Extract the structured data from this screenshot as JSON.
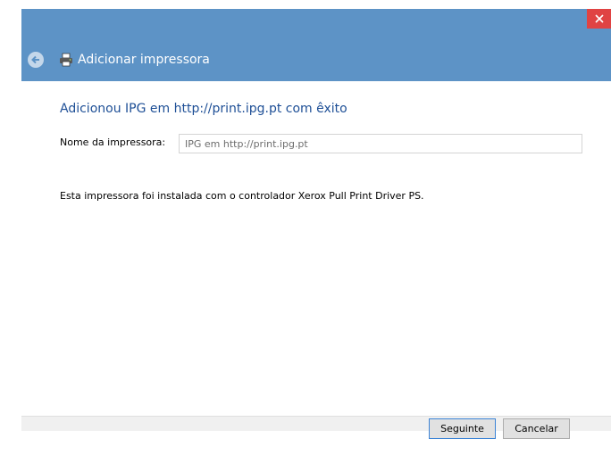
{
  "window": {
    "title": "Adicionar impressora"
  },
  "content": {
    "heading": "Adicionou IPG em http://print.ipg.pt com êxito",
    "printer_name_label": "Nome da impressora:",
    "printer_name_value": "IPG em http://print.ipg.pt",
    "info": "Esta impressora foi instalada com o controlador Xerox Pull Print Driver PS."
  },
  "footer": {
    "next_label": "Seguinte",
    "cancel_label": "Cancelar"
  },
  "colors": {
    "header_bg": "#5d93c6",
    "close_bg": "#e04343",
    "heading_text": "#1e4f96"
  },
  "icons": {
    "close": "close-icon",
    "back": "back-arrow-icon",
    "printer": "printer-icon"
  }
}
